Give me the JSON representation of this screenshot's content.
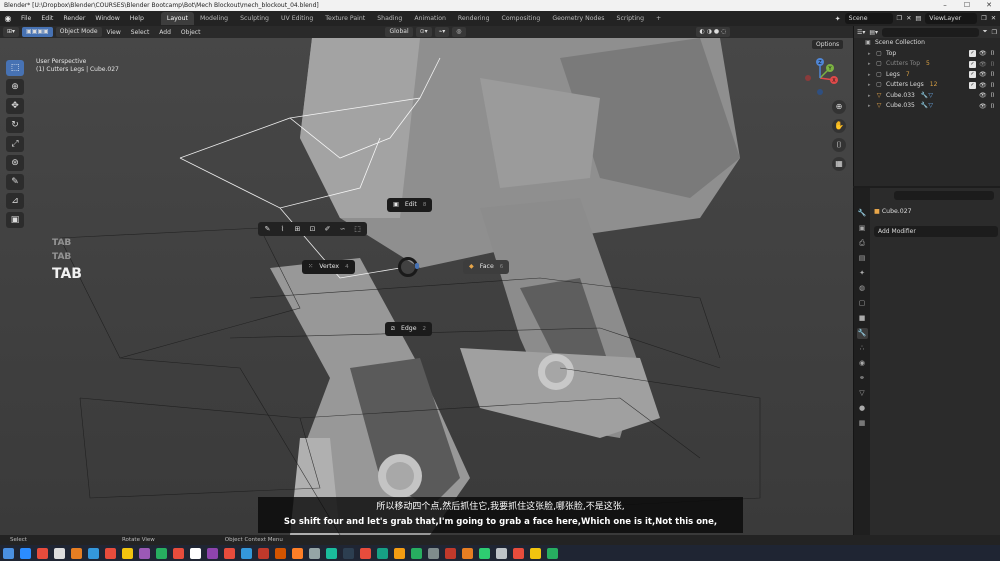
{
  "window": {
    "title": "Blender* [U:\\Dropbox\\Blender\\COURSES\\Blender Bootcamp\\Bot\\Mech Blockout\\mech_blockout_04.blend]",
    "controls": [
      "–",
      "☐",
      "✕"
    ]
  },
  "menubar": {
    "items": [
      "File",
      "Edit",
      "Render",
      "Window",
      "Help"
    ],
    "workspaces": [
      "Layout",
      "Modeling",
      "Sculpting",
      "UV Editing",
      "Texture Paint",
      "Shading",
      "Animation",
      "Rendering",
      "Compositing",
      "Geometry Nodes",
      "Scripting",
      "+"
    ],
    "active_workspace": "Layout",
    "scene": "Scene",
    "view_layer": "ViewLayer"
  },
  "viewport_header": {
    "mode": "Object Mode",
    "menus": [
      "View",
      "Select",
      "Add",
      "Object"
    ],
    "orientation": "Global",
    "options": "Options"
  },
  "viewport": {
    "perspective": "User Perspective",
    "selection": "(1) Cutters Legs | Cube.027",
    "gizmo_axes": [
      "X",
      "Y",
      "Z"
    ]
  },
  "screencast_keys": [
    "TAB",
    "TAB",
    "TAB"
  ],
  "pie_menu": {
    "edit": {
      "label": "Edit",
      "num": "8"
    },
    "vertex": {
      "label": "Vertex",
      "num": "4"
    },
    "face": {
      "label": "Face",
      "num": "6"
    },
    "edge": {
      "label": "Edge",
      "num": "2"
    }
  },
  "subtitles": {
    "zh": "所以移动四个点,然后抓住它,我要抓住这张脸,哪张脸,不是这张,",
    "en": "So shift four and let's grab that,I'm going to grab a face here,Which one is it,Not this one,"
  },
  "outliner": {
    "root": "Scene Collection",
    "rows": [
      {
        "label": "Top",
        "icon": "collection-icon",
        "extra": ""
      },
      {
        "label": "Cutters Top",
        "icon": "collection-icon",
        "extra": "5",
        "dim": true
      },
      {
        "label": "Legs",
        "icon": "collection-icon",
        "extra": "7"
      },
      {
        "label": "Cutters Legs",
        "icon": "collection-icon",
        "extra": "12"
      },
      {
        "label": "Cube.033",
        "icon": "mesh-icon",
        "extra": ""
      },
      {
        "label": "Cube.035",
        "icon": "mesh-icon",
        "extra": ""
      }
    ]
  },
  "properties": {
    "object": "Cube.027",
    "add_modifier": "Add Modifier"
  },
  "statusbar": {
    "items": [
      "Select",
      "Rotate View",
      "Object Context Menu"
    ]
  },
  "colors": {
    "accent": "#4772b3",
    "viewport_bg": "#4a4a4a",
    "panel_bg": "#2b2b2b"
  }
}
